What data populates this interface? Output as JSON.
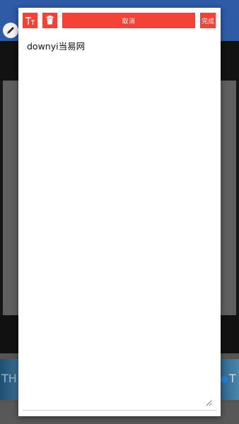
{
  "dialog": {
    "text_size_icon": "text-size-icon",
    "delete_icon": "trash-icon",
    "cancel_label": "取消",
    "done_label": "完成",
    "text_value": "downyi当易网",
    "accent_color": "#f44336"
  },
  "background": {
    "header_color": "#2f5aa6",
    "edit_icon": "pencil-icon",
    "thumb_left_text": "TH",
    "thumb_right_text": "T"
  }
}
